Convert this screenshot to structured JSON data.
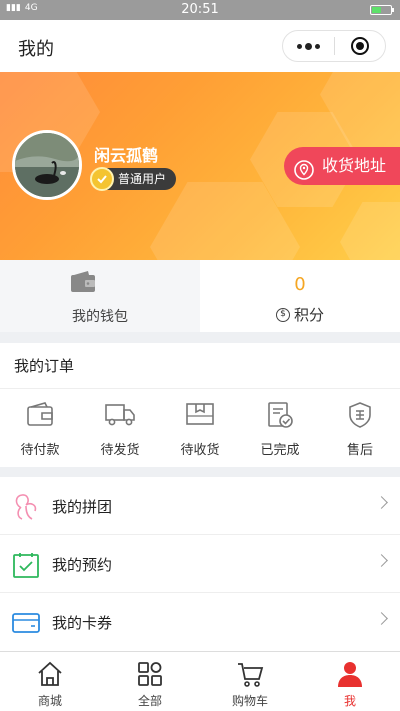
{
  "status_bar": {
    "signal_text": "4G",
    "time": "20:51"
  },
  "nav": {
    "title": "我的"
  },
  "profile": {
    "nickname": "闲云孤鹤",
    "level": "普通用户",
    "address_button": "收货地址"
  },
  "stats": {
    "wallet_label": "我的钱包",
    "points_value": "0",
    "points_label": "积分"
  },
  "orders": {
    "title": "我的订单",
    "items": [
      {
        "label": "待付款",
        "icon": "wallet-icon"
      },
      {
        "label": "待发货",
        "icon": "truck-icon"
      },
      {
        "label": "待收货",
        "icon": "package-icon"
      },
      {
        "label": "已完成",
        "icon": "completed-doc-icon"
      },
      {
        "label": "售后",
        "icon": "after-sales-shield-icon"
      }
    ]
  },
  "menu": {
    "items": [
      {
        "label": "我的拼团",
        "icon": "group-buy-icon",
        "color": "#f48fb1"
      },
      {
        "label": "我的预约",
        "icon": "calendar-check-icon",
        "color": "#2eb85c"
      },
      {
        "label": "我的卡券",
        "icon": "card-icon",
        "color": "#2b8be0"
      }
    ]
  },
  "tabbar": {
    "items": [
      {
        "label": "商城",
        "icon": "home-icon",
        "active": false
      },
      {
        "label": "全部",
        "icon": "grid-icon",
        "active": false
      },
      {
        "label": "购物车",
        "icon": "cart-icon",
        "active": false
      },
      {
        "label": "我",
        "icon": "person-icon",
        "active": true
      }
    ],
    "active_color": "#e8312f"
  }
}
